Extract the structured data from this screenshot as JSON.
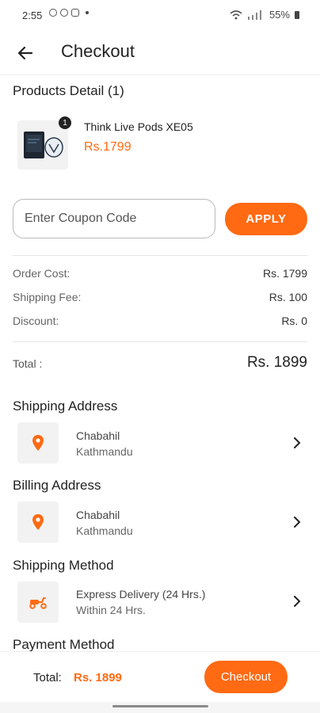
{
  "status_bar": {
    "time": "2:55",
    "battery": "55%"
  },
  "header": {
    "title": "Checkout"
  },
  "products": {
    "section_title": "Products Detail (1)",
    "items": [
      {
        "name": "Think Live Pods XE05",
        "price": "Rs.1799",
        "quantity": "1"
      }
    ]
  },
  "coupon": {
    "placeholder": "Enter Coupon Code",
    "value": "",
    "apply_label": "APPLY"
  },
  "costs": {
    "order_cost_label": "Order Cost:",
    "order_cost_value": "Rs. 1799",
    "shipping_fee_label": "Shipping Fee:",
    "shipping_fee_value": "Rs. 100",
    "discount_label": "Discount:",
    "discount_value": "Rs. 0",
    "total_label": "Total :",
    "total_value": "Rs. 1899"
  },
  "shipping_address": {
    "title": "Shipping Address",
    "line1": "Chabahil",
    "line2": "Kathmandu",
    "icon": "location-pin-icon"
  },
  "billing_address": {
    "title": "Billing Address",
    "line1": "Chabahil",
    "line2": "Kathmandu",
    "icon": "location-pin-icon"
  },
  "shipping_method": {
    "title": "Shipping Method",
    "line1": "Express Delivery (24 Hrs.)",
    "line2": "Within 24 Hrs.",
    "icon": "scooter-icon"
  },
  "payment_method": {
    "title": "Payment Method"
  },
  "footer": {
    "total_label": "Total:",
    "total_value": "Rs. 1899",
    "checkout_label": "Checkout"
  },
  "colors": {
    "accent": "#ff6a13",
    "icon_bg": "#f2f2f2",
    "divider": "#e6e6e6"
  }
}
